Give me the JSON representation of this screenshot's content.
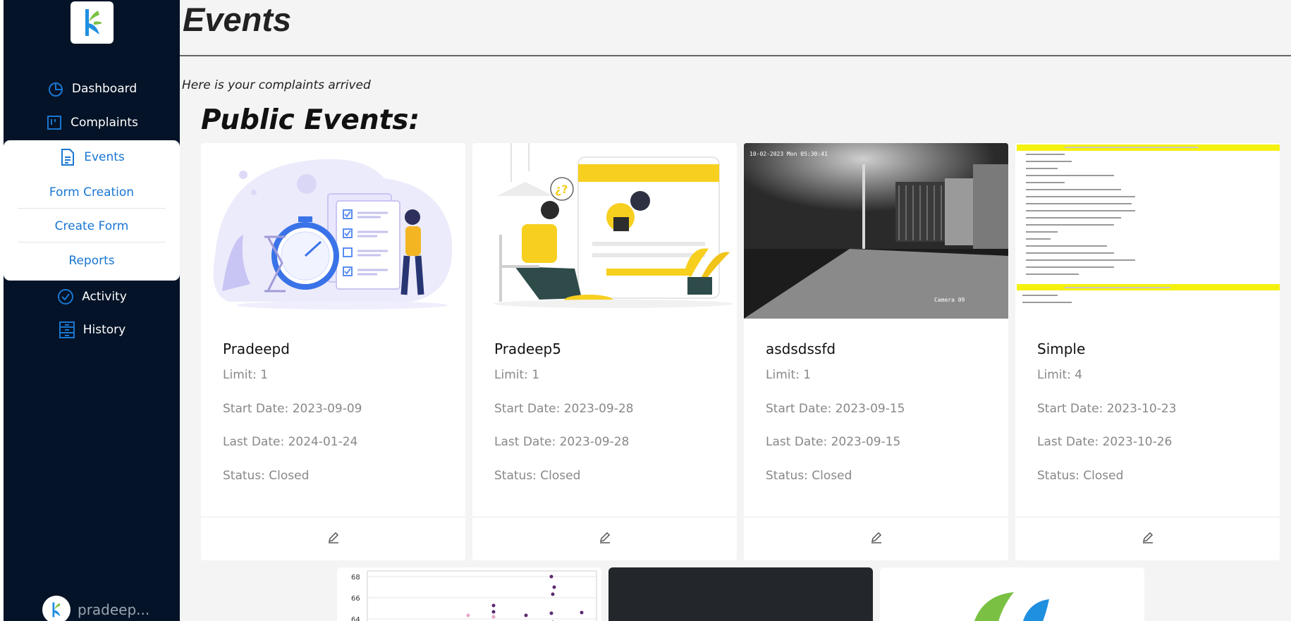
{
  "sidebar": {
    "nav": {
      "dashboard": "Dashboard",
      "complaints": "Complaints",
      "events": "Events",
      "activity": "Activity",
      "history": "History"
    },
    "submenu": {
      "form_creation": "Form Creation",
      "create_form": "Create Form",
      "reports": "Reports"
    },
    "user_name": "pradeep..."
  },
  "page": {
    "title": "Events",
    "subtitle": "Here is your complaints arrived",
    "section_title": "Public Events:"
  },
  "events": [
    {
      "name": "Pradeepd",
      "limit": "Limit: 1",
      "start": "Start Date: 2023-09-09",
      "last": "Last Date: 2024-01-24",
      "status": "Status: Closed"
    },
    {
      "name": "Pradeep5",
      "limit": "Limit: 1",
      "start": "Start Date: 2023-09-28",
      "last": "Last Date: 2023-09-28",
      "status": "Status: Closed"
    },
    {
      "name": "asdsdssfd",
      "limit": "Limit: 1",
      "start": "Start Date: 2023-09-15",
      "last": "Last Date: 2023-09-15",
      "status": "Status: Closed"
    },
    {
      "name": "Simple",
      "limit": "Limit: 4",
      "start": "Start Date: 2023-10-23",
      "last": "Last Date: 2023-10-26",
      "status": "Status: Closed"
    }
  ],
  "camera_overlay": {
    "timestamp": "10-02-2023 Mon 05:30:41",
    "label": "Camera 09"
  },
  "thumb_chart_ticks": [
    "68",
    "66",
    "64"
  ],
  "colors": {
    "sidebar_bg": "#041327",
    "accent": "#1976d2",
    "highlight_yellow": "#f5d200"
  },
  "icons": {
    "dashboard": "pie-chart-icon",
    "complaints": "kanban-icon",
    "events": "document-icon",
    "activity": "check-circle-icon",
    "history": "archive-icon",
    "edit": "pencil-icon"
  }
}
